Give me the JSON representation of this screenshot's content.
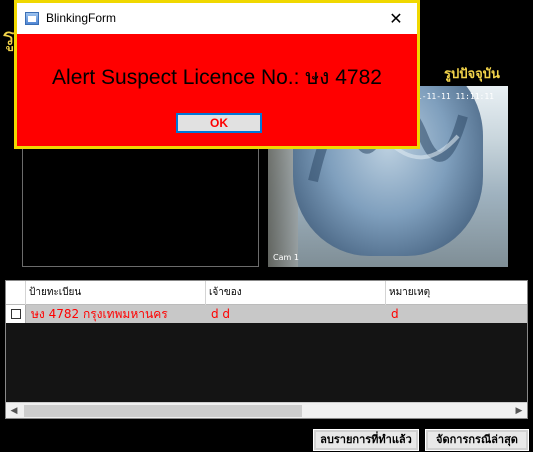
{
  "main": {
    "title_fragment": "รู",
    "current_photo_label": "รูปปัจจุบัน",
    "photo_timestamp": "11-11-11 11:11:11",
    "photo_caption": "Cam 1"
  },
  "grid": {
    "columns": [
      "ป้ายทะเบียน",
      "เจ้าของ",
      "หมายเหตุ"
    ],
    "rows": [
      {
        "plate": "ษง 4782 กรุงเทพมหานคร",
        "owner": "d d",
        "note": "d"
      }
    ]
  },
  "buttons": {
    "done_list": "ลบรายการที่ทำแล้ว",
    "manage_case": "จัดการกรณีล่าสุด"
  },
  "dialog": {
    "title": "BlinkingForm",
    "close_glyph": "✕",
    "message": "Alert Suspect Licence No.: ษง 4782",
    "ok_label": "OK"
  },
  "colors": {
    "dialog_background": "#ff0000",
    "dialog_border": "#f0d800",
    "alert_text": "#ff0000",
    "label_yellow": "#f2d34a"
  }
}
